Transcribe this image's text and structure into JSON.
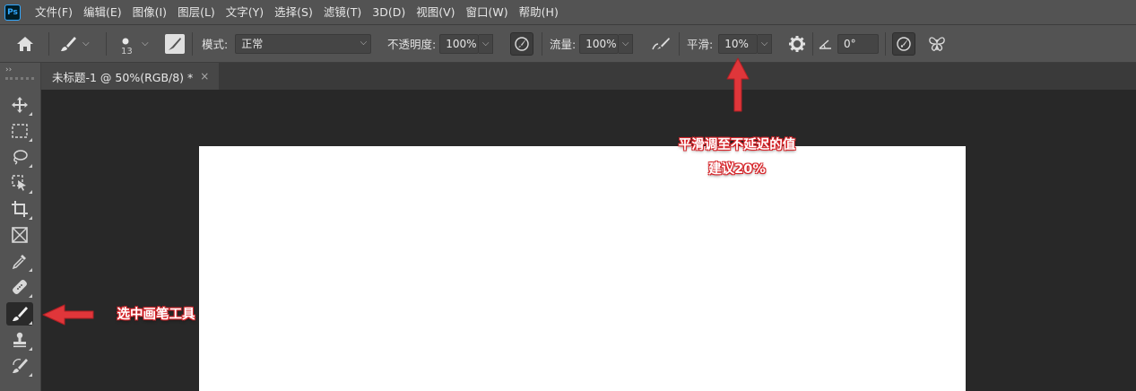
{
  "app": {
    "logo": "Ps"
  },
  "menu": [
    "文件(F)",
    "编辑(E)",
    "图像(I)",
    "图层(L)",
    "文字(Y)",
    "选择(S)",
    "滤镜(T)",
    "3D(D)",
    "视图(V)",
    "窗口(W)",
    "帮助(H)"
  ],
  "options": {
    "brush_size": "13",
    "mode_label": "模式:",
    "mode_value": "正常",
    "opacity_label": "不透明度:",
    "opacity_value": "100%",
    "flow_label": "流量:",
    "flow_value": "100%",
    "smoothing_label": "平滑:",
    "smoothing_value": "10%",
    "angle_value": "0°"
  },
  "document_tab": {
    "title": "未标题-1 @ 50%(RGB/8) *",
    "close": "×"
  },
  "toolbar": {
    "collapse_glyph": "››",
    "tools": [
      "move-tool",
      "marquee-tool",
      "lasso-tool",
      "object-selection-tool",
      "crop-tool",
      "frame-tool",
      "eyedropper-tool",
      "healing-tool",
      "brush-tool",
      "stamp-tool",
      "history-brush-tool"
    ],
    "active": "brush-tool"
  },
  "annotations": {
    "smoothing_note_line1": "平滑调至不延迟的值",
    "smoothing_note_line2": "建议20%",
    "brush_note": "选中画笔工具",
    "color": "#d7262b"
  }
}
